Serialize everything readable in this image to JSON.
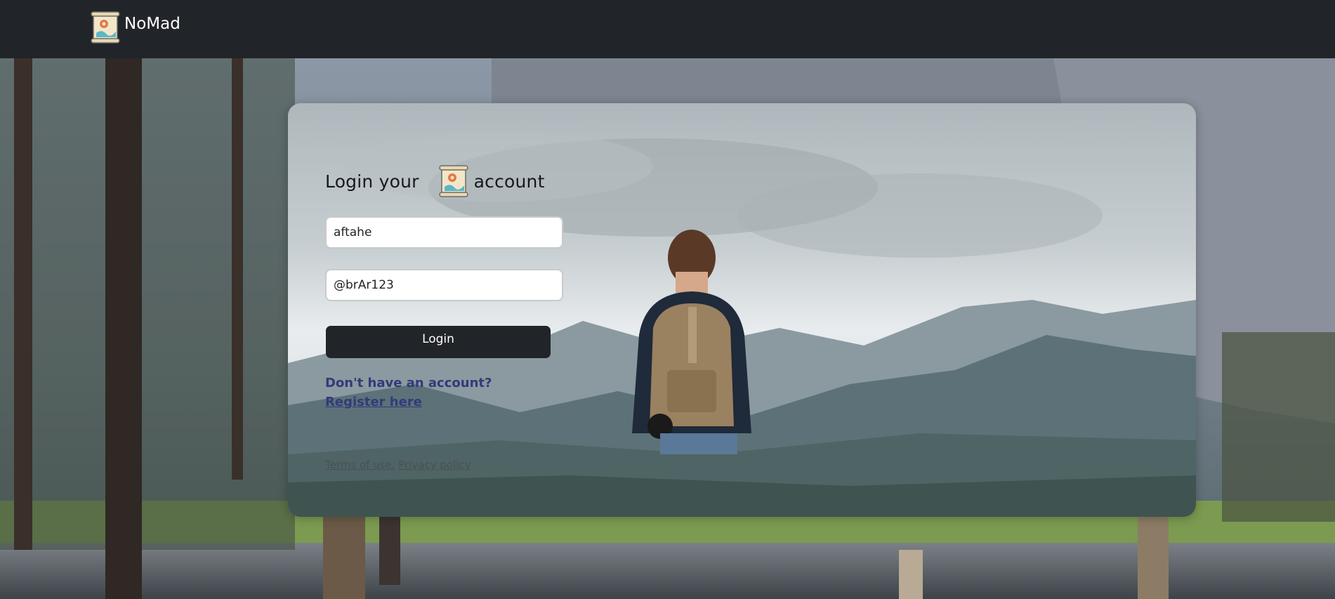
{
  "navbar": {
    "brand_name": "NoMad",
    "brand_icon": "map-scroll-icon"
  },
  "login": {
    "title_before": "Login your",
    "title_after": "account",
    "title_icon": "map-scroll-icon",
    "username_value": "aftahe",
    "password_value": "@brAr123",
    "button_label": "Login",
    "register_prompt": "Don't have an account?",
    "register_link": "Register here"
  },
  "footer": {
    "terms": "Terms of use.",
    "privacy": "Privacy policy"
  },
  "colors": {
    "navbar": "#212428",
    "button": "#212428",
    "register_text": "#333a7a",
    "footer_text": "#4a5058"
  }
}
